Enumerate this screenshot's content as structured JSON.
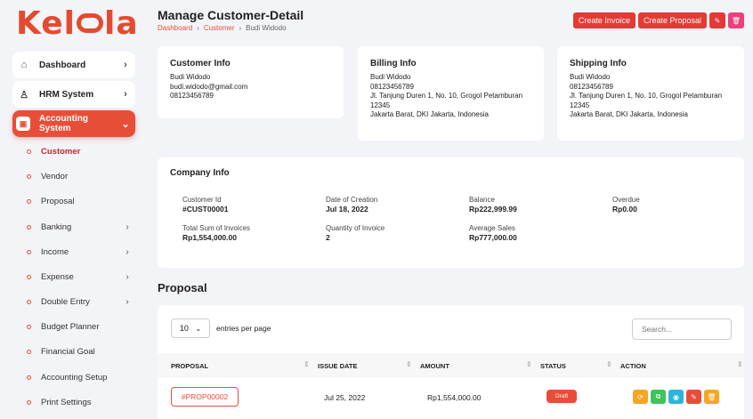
{
  "brand": {
    "logo": "Kelola"
  },
  "sidebar": {
    "main": [
      {
        "label": "Dashboard",
        "icon": "home-icon"
      },
      {
        "label": "HRM System",
        "icon": "user-icon"
      },
      {
        "label": "Accounting System",
        "icon": "box-icon",
        "active": true
      }
    ],
    "sub": [
      {
        "label": "Customer",
        "active": true
      },
      {
        "label": "Vendor"
      },
      {
        "label": "Proposal"
      },
      {
        "label": "Banking",
        "chevron": true
      },
      {
        "label": "Income",
        "chevron": true
      },
      {
        "label": "Expense",
        "chevron": true
      },
      {
        "label": "Double Entry",
        "chevron": true
      },
      {
        "label": "Budget Planner"
      },
      {
        "label": "Financial Goal"
      },
      {
        "label": "Accounting Setup"
      },
      {
        "label": "Print Settings"
      }
    ]
  },
  "header": {
    "title": "Manage Customer-Detail",
    "breadcrumb": [
      "Dashboard",
      "Customer",
      "Budi Widodo"
    ],
    "create_invoice": "Create Invoice",
    "create_proposal": "Create Proposal"
  },
  "customer_info": {
    "title": "Customer Info",
    "name": "Budi Widodo",
    "email": "budi.widodo@gmail.com",
    "phone": "08123456789"
  },
  "billing_info": {
    "title": "Billing Info",
    "name": "Budi Widodo",
    "phone": "08123456789",
    "address1": "Jl. Tanjung Duren 1, No. 10, Grogol Petamburan",
    "zip": "12345",
    "city": "Jakarta Barat, DKI Jakarta, Indonesia"
  },
  "shipping_info": {
    "title": "Shipping Info",
    "name": "Budi Widodo",
    "phone": "08123456789",
    "address1": "Jl. Tanjung Duren 1, No. 10, Grogol Petamburan",
    "zip": "12345",
    "city": "Jakarta Barat, DKI Jakarta, Indonesia"
  },
  "company_info": {
    "title": "Company Info",
    "customer_id_label": "Customer Id",
    "customer_id": "#CUST00001",
    "date_label": "Date of Creation",
    "date": "Jul 18, 2022",
    "balance_label": "Balance",
    "balance": "Rp222,999.99",
    "overdue_label": "Overdue",
    "overdue": "Rp0.00",
    "total_invoices_label": "Total Sum of Invoices",
    "total_invoices": "Rp1,554,000.00",
    "qty_invoice_label": "Quantity of Invoice",
    "qty_invoice": "2",
    "avg_sales_label": "Average Sales",
    "avg_sales": "Rp777,000.00"
  },
  "proposal": {
    "title": "Proposal",
    "entries_value": "10",
    "entries_text": "entries per page",
    "search_placeholder": "Search...",
    "columns": [
      "PROPOSAL",
      "ISSUE DATE",
      "AMOUNT",
      "STATUS",
      "ACTION"
    ],
    "rows": [
      {
        "id": "#PROP00002",
        "issue_date": "Jul 25, 2022",
        "amount": "Rp1,554,000.00",
        "status": "Draft"
      }
    ]
  },
  "colors": {
    "accent": "#e84e37",
    "action_convert": "#f6a623",
    "action_copy": "#3ec45a",
    "action_view": "#29b6d8",
    "action_edit": "#e84e37",
    "action_delete": "#f6a623"
  }
}
